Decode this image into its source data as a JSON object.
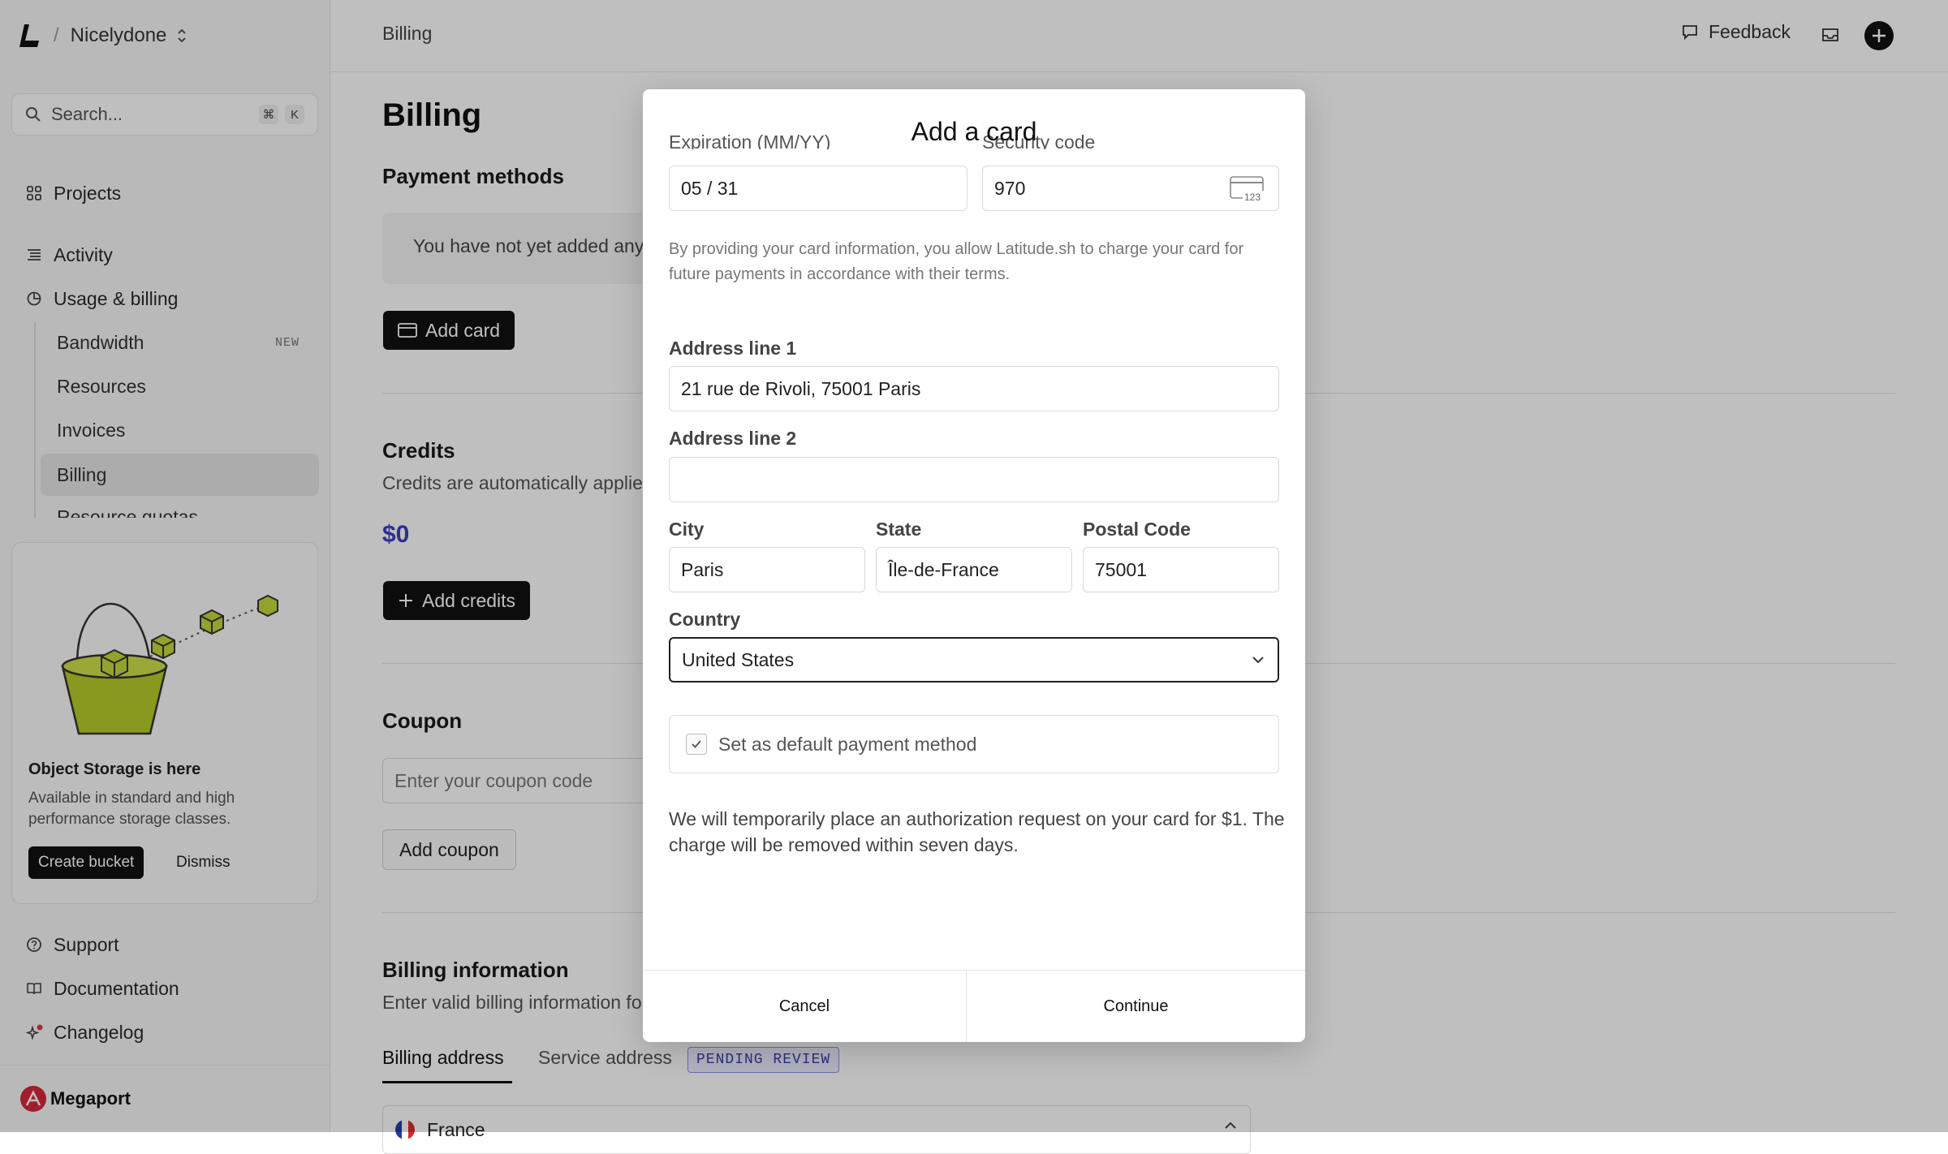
{
  "sidebar": {
    "org_name": "Nicelydone",
    "search_placeholder": "Search...",
    "search_shortcut": [
      "⌘",
      "K"
    ],
    "nav": {
      "projects": "Projects",
      "activity": "Activity",
      "usage_billing": "Usage & billing"
    },
    "sub_items": {
      "bandwidth": "Bandwidth",
      "bandwidth_tag": "NEW",
      "resources": "Resources",
      "invoices": "Invoices",
      "billing": "Billing",
      "resource_quotas": "Resource quotas"
    },
    "promo": {
      "title": "Object Storage is here",
      "description": "Available in standard and high performance storage classes.",
      "primary_button": "Create bucket",
      "secondary_button": "Dismiss",
      "accent_color": "#b5cc2a"
    },
    "footer_nav": {
      "support": "Support",
      "documentation": "Documentation",
      "changelog": "Changelog"
    },
    "brand": "Megaport"
  },
  "topbar": {
    "breadcrumb": "Billing",
    "feedback": "Feedback"
  },
  "page": {
    "title": "Billing",
    "payment_methods": {
      "heading": "Payment methods",
      "empty_text": "You have not yet added any payment methods.",
      "add_button": "Add card"
    },
    "credits": {
      "heading": "Credits",
      "description": "Credits are automatically applied to your next invoice.",
      "amount": "$0",
      "amount_color": "#3b3fc0",
      "add_button": "Add credits"
    },
    "coupon": {
      "heading": "Coupon",
      "placeholder": "Enter your coupon code",
      "add_button": "Add coupon"
    },
    "billing_information": {
      "heading": "Billing information",
      "description": "Enter valid billing information for your invoices.",
      "tabs": [
        "Billing address",
        "Service address"
      ],
      "pending_badge": "PENDING REVIEW",
      "country": "France"
    }
  },
  "modal": {
    "title": "Add a card",
    "expiration_label": "Expiration (MM/YY)",
    "expiration_value": "05 / 31",
    "security_label": "Security code",
    "security_value": "970",
    "consent_note": "By providing your card information, you allow Latitude.sh to charge your card for future payments in accordance with their terms.",
    "address1_label": "Address line 1",
    "address1_value": "21 rue de Rivoli, 75001 Paris",
    "address2_label": "Address line 2",
    "address2_value": "",
    "city_label": "City",
    "city_value": "Paris",
    "state_label": "State",
    "state_value": "Île-de-France",
    "postal_label": "Postal Code",
    "postal_value": "75001",
    "country_label": "Country",
    "country_value": "United States",
    "default_checkbox_label": "Set as default payment method",
    "default_checked": true,
    "authorization_note": "We will temporarily place an authorization request on your card for $1. The charge will be removed within seven days.",
    "cancel_button": "Cancel",
    "continue_button": "Continue"
  }
}
